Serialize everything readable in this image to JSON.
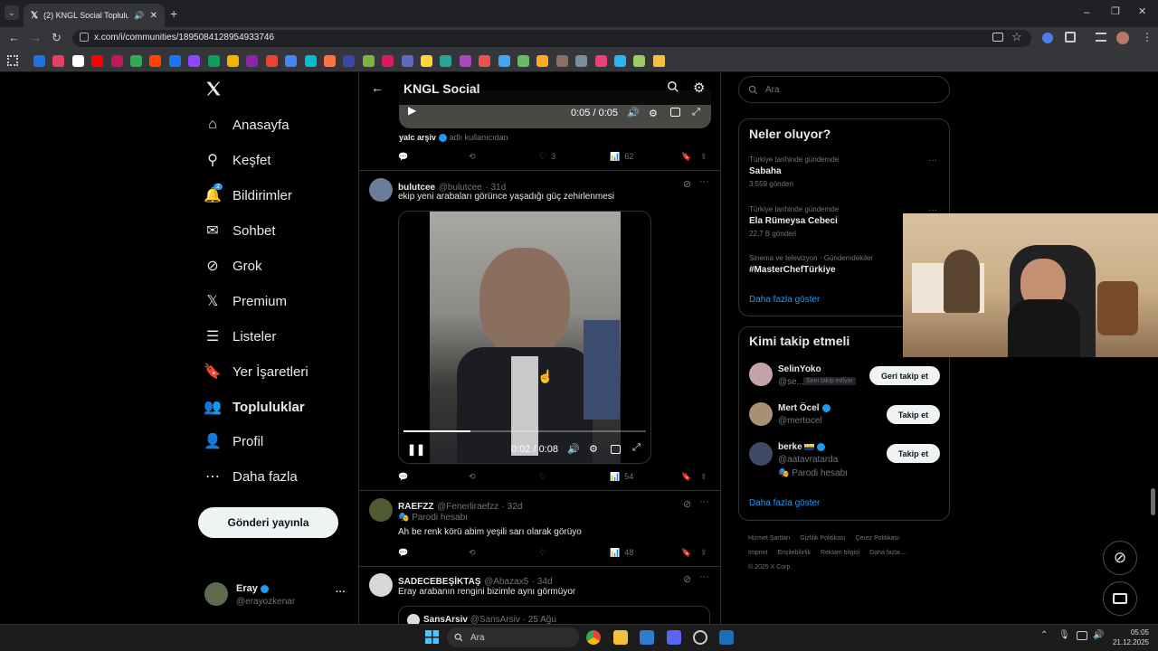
{
  "browser": {
    "tab_title": "(2) KNGL Social Topluluk / X",
    "url": "x.com/i/communities/1895084128954933746"
  },
  "sidebar": {
    "items": [
      {
        "label": "Anasayfa",
        "icon": "home-icon"
      },
      {
        "label": "Keşfet",
        "icon": "search-icon"
      },
      {
        "label": "Bildirimler",
        "icon": "bell-icon",
        "badge": "2"
      },
      {
        "label": "Sohbet",
        "icon": "mail-icon"
      },
      {
        "label": "Grok",
        "icon": "grok-icon"
      },
      {
        "label": "Premium",
        "icon": "x-logo-icon"
      },
      {
        "label": "Listeler",
        "icon": "list-icon"
      },
      {
        "label": "Yer İşaretleri",
        "icon": "bookmark-icon"
      },
      {
        "label": "Topluluklar",
        "icon": "people-icon"
      },
      {
        "label": "Profil",
        "icon": "person-icon"
      },
      {
        "label": "Daha fazla",
        "icon": "more-circle-icon"
      }
    ],
    "post_button": "Gönderi yayınla",
    "account": {
      "name": "Eray",
      "handle": "@erayozkenar",
      "more": "···"
    }
  },
  "header": {
    "title": "KNGL Social"
  },
  "feed": {
    "top_video": {
      "time": "0:05 / 0:05"
    },
    "top_credit": {
      "name": "yalc arşiv",
      "suffix": "adlı kullanıcıdan"
    },
    "top_actions": {
      "likes": "3",
      "views": "62"
    },
    "posts": [
      {
        "name": "bulutcee",
        "handle": "@bulutcee",
        "age": "· 31d",
        "text": "ekip yeni arabaları görünce yaşadığı güç zehirlenmesi",
        "video_time": "0:02 / 0:08",
        "views": "54"
      },
      {
        "name": "RAEFZZ",
        "handle": "@Fenerliraefzz",
        "age": "· 32d",
        "tag": "Parodi hesabı",
        "text": "Ah be renk körü abim yeşili sarı olarak görüyo",
        "views": "48"
      },
      {
        "name": "SADECEBEŞİKTAŞ",
        "handle": "@Abazax5",
        "age": "· 34d",
        "text": "Eray arabanın rengini bizimle aynı görmüyor",
        "quote_name": "SansArsiv",
        "quote_handle": "@SansArsiv",
        "quote_age": "· 25 Ağu"
      }
    ]
  },
  "right": {
    "search_placeholder": "Ara",
    "trends_title": "Neler oluyor?",
    "trends": [
      {
        "context": "Türkiye tarihinde gündemde",
        "title": "Sabaha",
        "count": "3.559 gönderi"
      },
      {
        "context": "Türkiye tarihinde gündemde",
        "title": "Ela Rümeysa Cebeci",
        "count": "22,7 B gönderi"
      },
      {
        "context": "Sinema ve televizyon · Gündemdekiler",
        "title": "#MasterChefTürkiye",
        "count": ""
      }
    ],
    "show_more": "Daha fazla göster",
    "who_title": "Kimi takip etmeli",
    "who": [
      {
        "name": "SelinYoko",
        "handle": "@se...",
        "follows_you": "Seni takip ediyor",
        "button": "Geri takip et"
      },
      {
        "name": "Mert Öcel",
        "handle": "@mertocel",
        "button": "Takip et"
      },
      {
        "name": "berke",
        "handle": "@aatavratarda",
        "tag": "Parodi hesabı",
        "button": "Takip et"
      }
    ],
    "who_more": "Daha fazla göster",
    "footer": [
      "Hizmet Şartları",
      "Gizlilik Politikası",
      "Çerez Politikası",
      "Imprint",
      "Erişilebilirlik",
      "Reklam bilgisi",
      "Daha fazla ...",
      "© 2025 X Corp."
    ]
  },
  "taskbar": {
    "search": "Ara",
    "time": "05:05",
    "date": "21.12.2025"
  }
}
